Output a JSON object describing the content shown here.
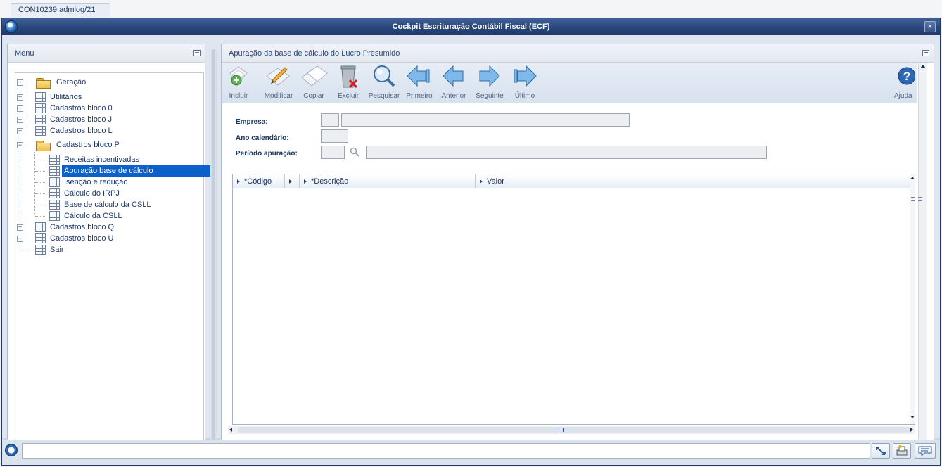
{
  "tab": {
    "label": "CON10239:admlog/21"
  },
  "window": {
    "title": "Cockpit Escrituração Contábil Fiscal (ECF)"
  },
  "menu": {
    "header": "Menu",
    "items": [
      {
        "label": "Geração",
        "icon": "folder-icon",
        "expander": "+"
      },
      {
        "label": "Utilitários",
        "icon": "grid-icon",
        "expander": "+"
      },
      {
        "label": "Cadastros bloco 0",
        "icon": "grid-icon",
        "expander": "+"
      },
      {
        "label": "Cadastros bloco J",
        "icon": "grid-icon",
        "expander": "+"
      },
      {
        "label": "Cadastros bloco L",
        "icon": "grid-icon",
        "expander": "+"
      },
      {
        "label": "Cadastros bloco P",
        "icon": "folder-open-icon",
        "expander": "−"
      },
      {
        "label": "Receitas incentivadas",
        "icon": "grid-icon"
      },
      {
        "label": "Apuração base de cálculo",
        "icon": "grid-icon",
        "selected": true
      },
      {
        "label": "Isenção e redução",
        "icon": "grid-icon"
      },
      {
        "label": "Cálculo do IRPJ",
        "icon": "grid-icon"
      },
      {
        "label": "Base de cálculo da CSLL",
        "icon": "grid-icon"
      },
      {
        "label": "Cálculo da CSLL",
        "icon": "grid-icon"
      },
      {
        "label": "Cadastros bloco Q",
        "icon": "grid-icon",
        "expander": "+"
      },
      {
        "label": "Cadastros bloco U",
        "icon": "grid-icon",
        "expander": "+"
      },
      {
        "label": "Sair",
        "icon": "grid-icon"
      }
    ]
  },
  "content": {
    "header": "Apuração da base de cálculo do Lucro Presumido",
    "toolbar": {
      "incluir": "Incluir",
      "modificar": "Modificar",
      "copiar": "Copiar",
      "excluir": "Excluir",
      "pesquisar": "Pesquisar",
      "primeiro": "Primeiro",
      "anterior": "Anterior",
      "seguinte": "Seguinte",
      "ultimo": "Último",
      "ajuda": "Ajuda"
    },
    "form": {
      "empresa_label": "Empresa:",
      "ano_label": "Ano calendário:",
      "periodo_label": "Período apuração:"
    },
    "grid": {
      "columns": [
        "*Código",
        "*Descrição",
        "Valor"
      ]
    }
  },
  "colors": {
    "selection": "#0b61c8",
    "titlebar": "#29477b",
    "panel_bg": "#dfe6ef"
  }
}
